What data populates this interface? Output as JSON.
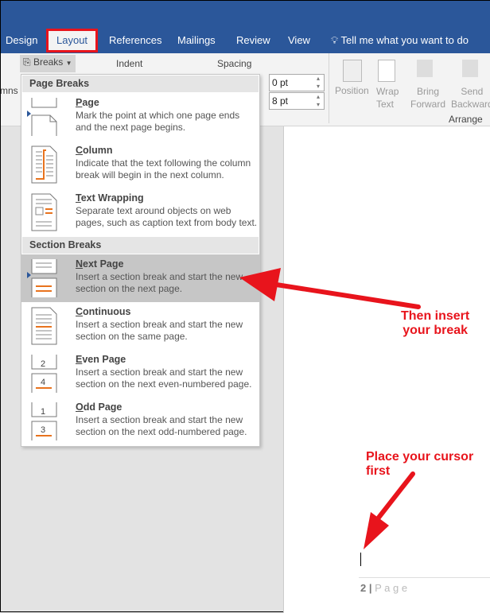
{
  "tabs": [
    "Design",
    "Layout",
    "References",
    "Mailings",
    "Review",
    "View"
  ],
  "tell_me": "Tell me what you want to do",
  "ribbon": {
    "breaks": "Breaks",
    "columns_partial": "mns",
    "indent": "Indent",
    "spacing": "Spacing",
    "before": "0 pt",
    "after": "8 pt",
    "position": "Position",
    "wrap_text": [
      "Wrap",
      "Text"
    ],
    "bring_forward": [
      "Bring",
      "Forward"
    ],
    "send_backward": [
      "Send",
      "Backward"
    ],
    "arrange": "Arrange"
  },
  "menu": {
    "page_breaks": "Page Breaks",
    "section_breaks": "Section Breaks",
    "items": [
      {
        "title": "Page",
        "key": "P",
        "rest": "age",
        "desc": [
          "Mark the point at which one page ends",
          "and the next page begins."
        ]
      },
      {
        "title": "Column",
        "key": "C",
        "rest": "olumn",
        "desc": [
          "Indicate that the text following the column",
          "break will begin in the next column."
        ]
      },
      {
        "title": "Text Wrapping",
        "key": "T",
        "rest": "ext Wrapping",
        "desc": [
          "Separate text around objects on web",
          "pages, such as caption text from body text."
        ]
      },
      {
        "title": "Next Page",
        "key": "N",
        "rest": "ext Page",
        "desc": [
          "Insert a section break and start the new",
          "section on the next page."
        ]
      },
      {
        "title": "Continuous",
        "key": "C",
        "rest": "ontinuous",
        "desc": [
          "Insert a section break and start the new",
          "section on the same page."
        ]
      },
      {
        "title": "Even Page",
        "key": "E",
        "rest": "ven Page",
        "desc": [
          "Insert a section break and start the new",
          "section on the next even-numbered page."
        ]
      },
      {
        "title": "Odd Page",
        "key": "O",
        "rest": "dd Page",
        "desc": [
          "Insert a section break and start the new",
          "section on the next odd-numbered page."
        ]
      }
    ]
  },
  "annotations": {
    "insert": [
      "Then insert",
      "your break"
    ],
    "cursor": [
      "Place your cursor",
      "first"
    ]
  },
  "footer": {
    "page_num": "2",
    "sep": "|",
    "page_word": "P a g e"
  }
}
